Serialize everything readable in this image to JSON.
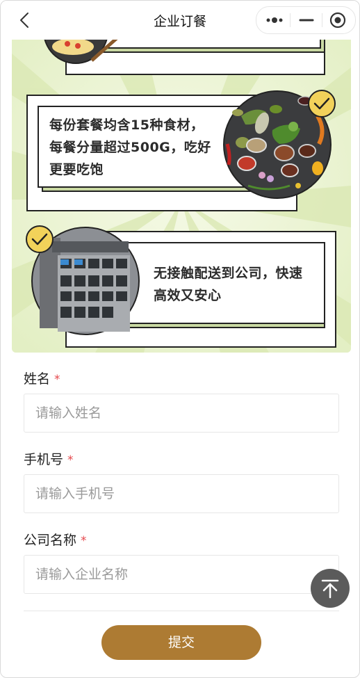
{
  "header": {
    "title": "企业订餐",
    "back_icon": "chevron-left-icon",
    "menu_icon": "more-dots-icon",
    "minimize_icon": "minimize-icon",
    "close_icon": "target-circle-icon"
  },
  "banner": {
    "cards": [
      {
        "text_line1": "每份套餐均含15种食材，",
        "text_line2": "每餐分量超过500G，吃好",
        "text_line3": "更要吃饱",
        "image": "spices-photo",
        "check_icon": "check-circle-icon"
      },
      {
        "text_line1": "无接触配送到公司，快速",
        "text_line2": "高效又安心",
        "image": "delivery-locker-photo",
        "check_icon": "check-circle-icon"
      }
    ],
    "colors": {
      "background": "#eef5d6",
      "check_yellow": "#f2d25a",
      "card_border": "#222222"
    }
  },
  "form": {
    "name": {
      "label": "姓名",
      "required_mark": "*",
      "placeholder": "请输入姓名",
      "value": ""
    },
    "phone": {
      "label": "手机号",
      "required_mark": "*",
      "placeholder": "请输入手机号",
      "value": ""
    },
    "company": {
      "label": "公司名称",
      "required_mark": "*",
      "placeholder": "请输入企业名称",
      "value": ""
    },
    "submit_label": "提交"
  },
  "colors": {
    "accent": "#ad7b33",
    "required": "#e5484d",
    "to_top_bg": "#5b5b5b"
  },
  "to_top_icon": "arrow-up-to-top-icon"
}
